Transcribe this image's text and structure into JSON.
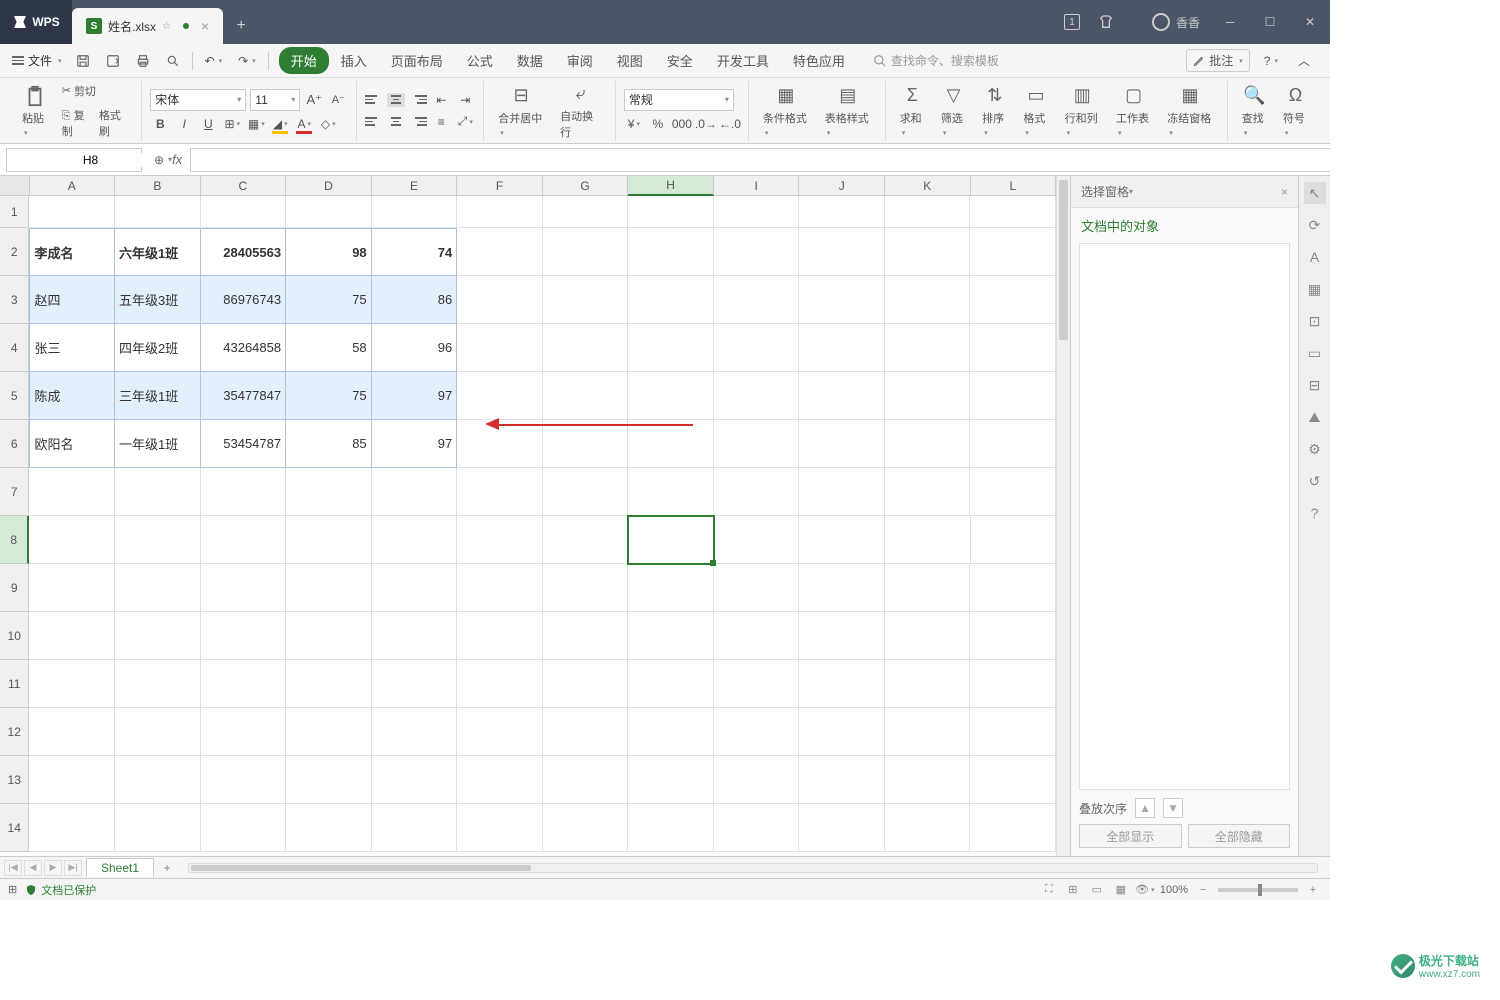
{
  "titlebar": {
    "app_name": "WPS",
    "tab_filename": "姓名.xlsx",
    "user_name": "香香"
  },
  "menubar": {
    "file": "文件",
    "tabs": [
      "开始",
      "插入",
      "页面布局",
      "公式",
      "数据",
      "审阅",
      "视图",
      "安全",
      "开发工具",
      "特色应用"
    ],
    "active_tab_index": 0,
    "search_placeholder": "查找命令、搜索模板",
    "annotate": "批注"
  },
  "ribbon": {
    "paste": "粘贴",
    "cut": "剪切",
    "copy": "复制",
    "format_painter": "格式刷",
    "font_name": "宋体",
    "font_size": "11",
    "merge_center": "合并居中",
    "auto_wrap": "自动换行",
    "number_format": "常规",
    "cond_format": "条件格式",
    "table_style": "表格样式",
    "sum": "求和",
    "filter": "筛选",
    "sort": "排序",
    "format": "格式",
    "rowcol": "行和列",
    "worksheet": "工作表",
    "freeze": "冻结窗格",
    "find": "查找",
    "symbol": "符号"
  },
  "name_box": {
    "value": "H8"
  },
  "columns": [
    "A",
    "B",
    "C",
    "D",
    "E",
    "F",
    "G",
    "H",
    "I",
    "J",
    "K",
    "L"
  ],
  "active_col_index": 7,
  "active_row_index": 7,
  "row_count": 14,
  "data_rows": [
    {
      "a": "李成名",
      "b": "六年级1班",
      "c": "28405563",
      "d": "98",
      "e": "74",
      "bold": true,
      "hl": false
    },
    {
      "a": "赵四",
      "b": "五年级3班",
      "c": "86976743",
      "d": "75",
      "e": "86",
      "bold": false,
      "hl": true
    },
    {
      "a": "张三",
      "b": "四年级2班",
      "c": "43264858",
      "d": "58",
      "e": "96",
      "bold": false,
      "hl": false
    },
    {
      "a": "陈成",
      "b": "三年级1班",
      "c": "35477847",
      "d": "75",
      "e": "97",
      "bold": false,
      "hl": true
    },
    {
      "a": "欧阳名",
      "b": "一年级1班",
      "c": "53454787",
      "d": "85",
      "e": "97",
      "bold": false,
      "hl": false
    }
  ],
  "right_panel": {
    "header": "选择窗格",
    "title": "文档中的对象",
    "stack_order": "叠放次序",
    "show_all": "全部显示",
    "hide_all": "全部隐藏"
  },
  "sheets": {
    "sheet1": "Sheet1"
  },
  "status": {
    "protected": "文档已保护",
    "zoom": "100%"
  },
  "watermark": {
    "text1": "极光下载站",
    "text2": "www.xz7.com"
  }
}
